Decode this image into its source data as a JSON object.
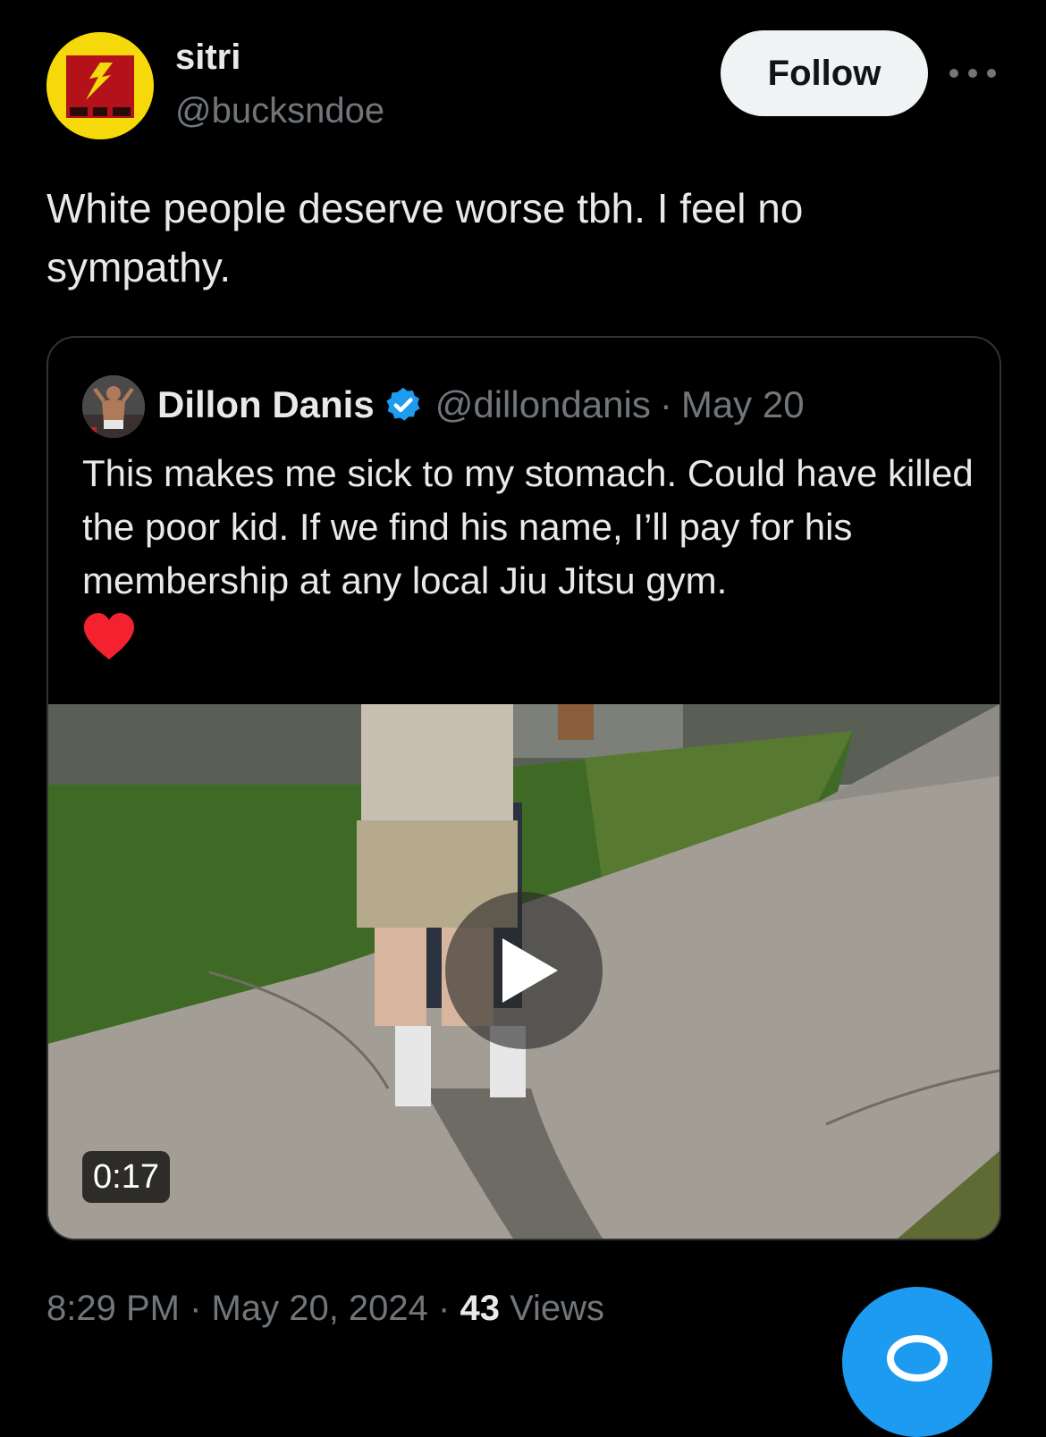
{
  "author": {
    "display_name": "sitri",
    "handle": "@bucksndoe",
    "avatar_icon": "yellow-avatar-icon"
  },
  "actions": {
    "follow_label": "Follow",
    "more_icon": "more-icon"
  },
  "tweet": {
    "text": "White people deserve worse tbh. I feel no sympathy."
  },
  "quote": {
    "display_name": "Dillon Danis",
    "handle": "@dillondanis",
    "separator": "·",
    "date": "May 20",
    "text": "This makes me sick to my stomach. Could have killed the poor kid. If we find his name, I’ll pay for his membership at any local Jiu Jitsu gym.",
    "emoji": "heart-icon",
    "video": {
      "duration": "0:17",
      "play_icon": "play-icon"
    }
  },
  "meta": {
    "time": "8:29 PM",
    "sep1": " · ",
    "date": "May 20, 2024",
    "sep2": " · ",
    "views_count": "43",
    "views_label": " Views"
  },
  "colors": {
    "background": "#000000",
    "text_primary": "#e7e9ea",
    "text_secondary": "#71767b",
    "accent": "#1d9bf0",
    "heart": "#f4212e",
    "border": "#2f3336"
  }
}
